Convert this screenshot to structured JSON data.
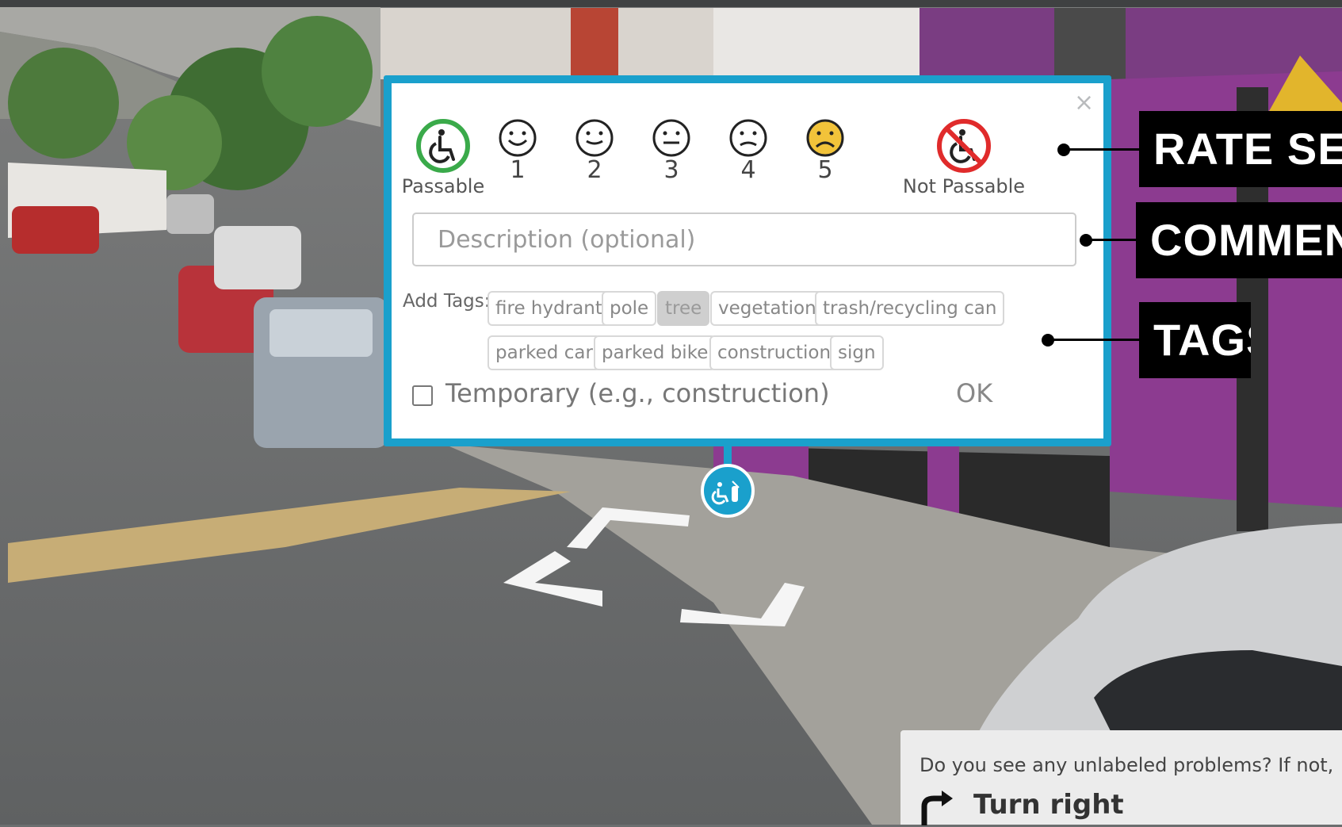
{
  "colors": {
    "accent": "#1aa0cc",
    "passable_green": "#3aaa4a",
    "not_passable_red": "#e02b2b",
    "face5_yellow": "#f2c33a"
  },
  "severity": {
    "passable_label": "Passable",
    "not_passable_label": "Not Passable",
    "levels": [
      "1",
      "2",
      "3",
      "4",
      "5"
    ]
  },
  "description": {
    "placeholder": "Description (optional)"
  },
  "tags": {
    "label": "Add Tags:",
    "items": [
      "fire hydrant",
      "pole",
      "tree",
      "vegetation",
      "trash/recycling can",
      "parked car",
      "parked bike",
      "construction",
      "sign"
    ],
    "selected": "tree"
  },
  "temporary": {
    "label": "Temporary (e.g., construction)",
    "checked": false
  },
  "ok_label": "OK",
  "close_glyph": "×",
  "callouts": {
    "rate_severity": "RATE SEVER",
    "comments": "COMMENTS",
    "tags": "TAGS"
  },
  "bottom": {
    "question": "Do you see any unlabeled problems? If not,",
    "turn_label": "Turn right"
  },
  "icons": [
    "close-icon",
    "wheelchair-icon",
    "smiley-face-icon",
    "no-wheelchair-icon",
    "turn-right-arrow-icon",
    "label-pin-icon"
  ]
}
